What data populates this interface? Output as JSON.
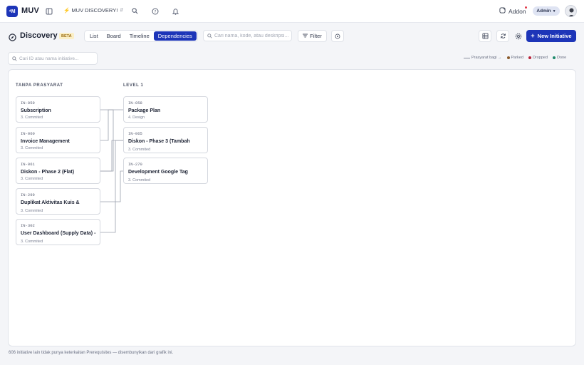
{
  "topbar": {
    "logo_text": "⁴M",
    "brand": "MUV",
    "workspace": "⚡ MUV DISCOVERY!",
    "addon_label": "Addon",
    "admin_label": "Admin"
  },
  "header": {
    "title": "Discovery",
    "badge": "BETA",
    "tabs": [
      {
        "label": "List",
        "active": false
      },
      {
        "label": "Board",
        "active": false
      },
      {
        "label": "Timeline",
        "active": false
      },
      {
        "label": "Dependencies",
        "active": true
      }
    ],
    "search_placeholder": "Cari nama, kode, atau deskripsi...",
    "filter_label": "Filter",
    "new_button_label": "New Initiative"
  },
  "toolbar": {
    "id_search_placeholder": "Cari ID atau nama initiative..."
  },
  "legend": {
    "link_label": "Prasyarat bagi →",
    "items": [
      {
        "label": "Parked",
        "color": "#8a5a2b"
      },
      {
        "label": "Dropped",
        "color": "#b8233a"
      },
      {
        "label": "Done",
        "color": "#1f8a6b"
      }
    ]
  },
  "columns": [
    {
      "heading": "TANPA PRASYARAT",
      "cards": [
        {
          "id": "IN-059",
          "name": "Subscription",
          "stage": "3. Commited"
        },
        {
          "id": "IN-060",
          "name": "Invoice Management",
          "stage": "3. Commited"
        },
        {
          "id": "IN-061",
          "name": "Diskon - Phase 2 (Flat)",
          "stage": "3. Commited"
        },
        {
          "id": "IN-299",
          "name": "Duplikat Aktivitas Kuis &",
          "stage": "3. Commited"
        },
        {
          "id": "IN-302",
          "name": "User Dashboard (Supply Data) -",
          "stage": "3. Commited"
        }
      ]
    },
    {
      "heading": "LEVEL 1",
      "cards": [
        {
          "id": "IN-058",
          "name": "Package Plan",
          "stage": "4. Design"
        },
        {
          "id": "IN-065",
          "name": "Diskon - Phase 3 (Tambah",
          "stage": "3. Commited"
        },
        {
          "id": "IN-270",
          "name": "Development Google Tag",
          "stage": "3. Commited"
        }
      ]
    }
  ],
  "footer": "606 initiative lain tidak punya keterkaitan Prerequisites — disembunyikan dari grafik ini."
}
